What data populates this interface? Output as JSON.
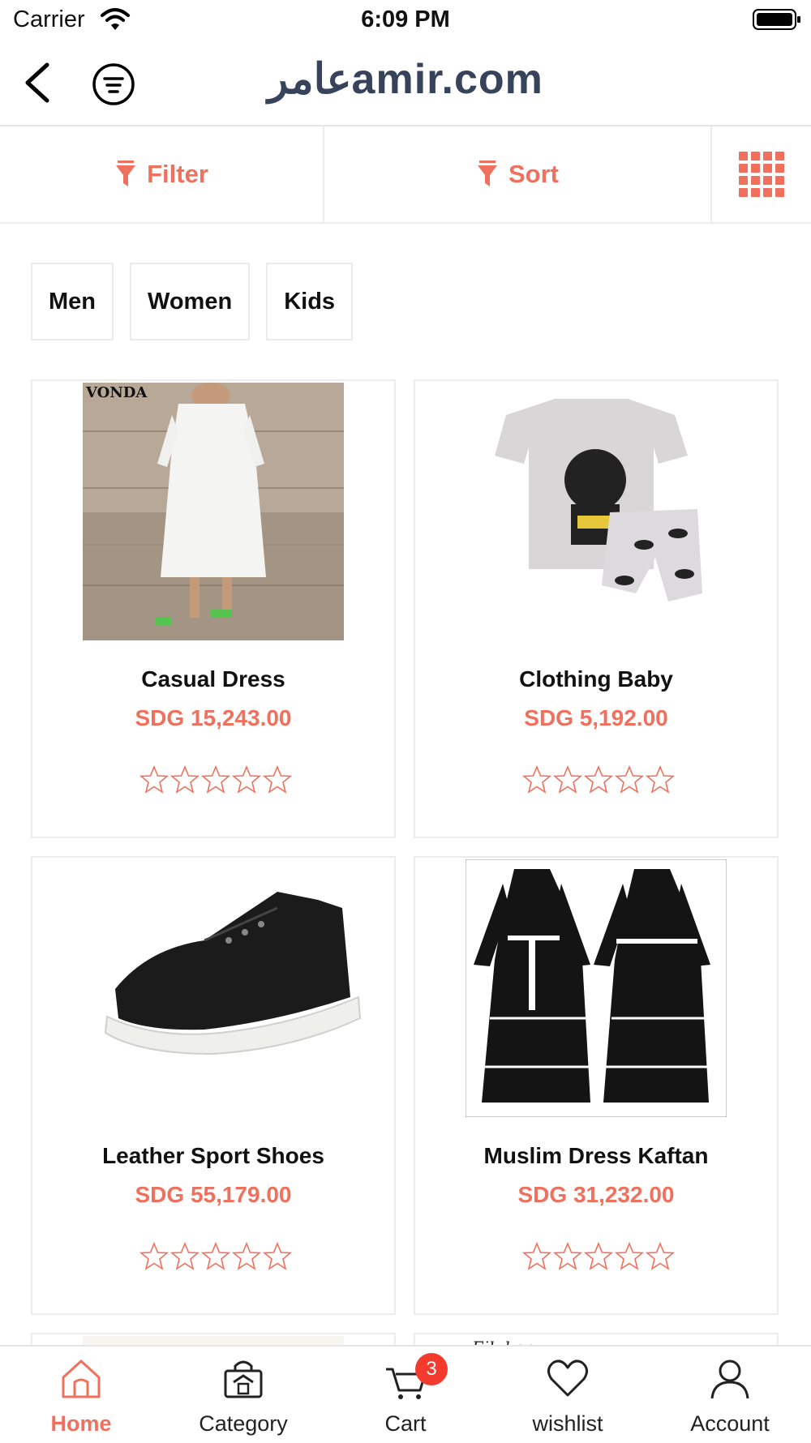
{
  "status_bar": {
    "carrier": "Carrier",
    "time": "6:09 PM"
  },
  "header": {
    "logo_arabic": "عامر",
    "logo_text": "amir.com"
  },
  "toolbar": {
    "filter_label": "Filter",
    "sort_label": "Sort",
    "grid_icon": "grid-view-icon"
  },
  "categories": [
    "Men",
    "Women",
    "Kids"
  ],
  "products": [
    {
      "title": "Casual Dress",
      "price": "SDG 15,243.00",
      "rating": 0,
      "image_caption": "VONDA"
    },
    {
      "title": "Clothing Baby",
      "price": "SDG 5,192.00",
      "rating": 0
    },
    {
      "title": "Leather Sport Shoes",
      "price": "SDG 55,179.00",
      "rating": 0
    },
    {
      "title": "Muslim Dress Kaftan",
      "price": "SDG 31,232.00",
      "rating": 0
    },
    {
      "image_caption": "Eilukea"
    }
  ],
  "tabbar": {
    "items": [
      "Home",
      "Category",
      "Cart",
      "wishlist",
      "Account"
    ],
    "cart_badge": "3",
    "active": "Home"
  },
  "colors": {
    "accent": "#f0705e",
    "brand": "#37435b",
    "badge": "#f23b2e"
  }
}
